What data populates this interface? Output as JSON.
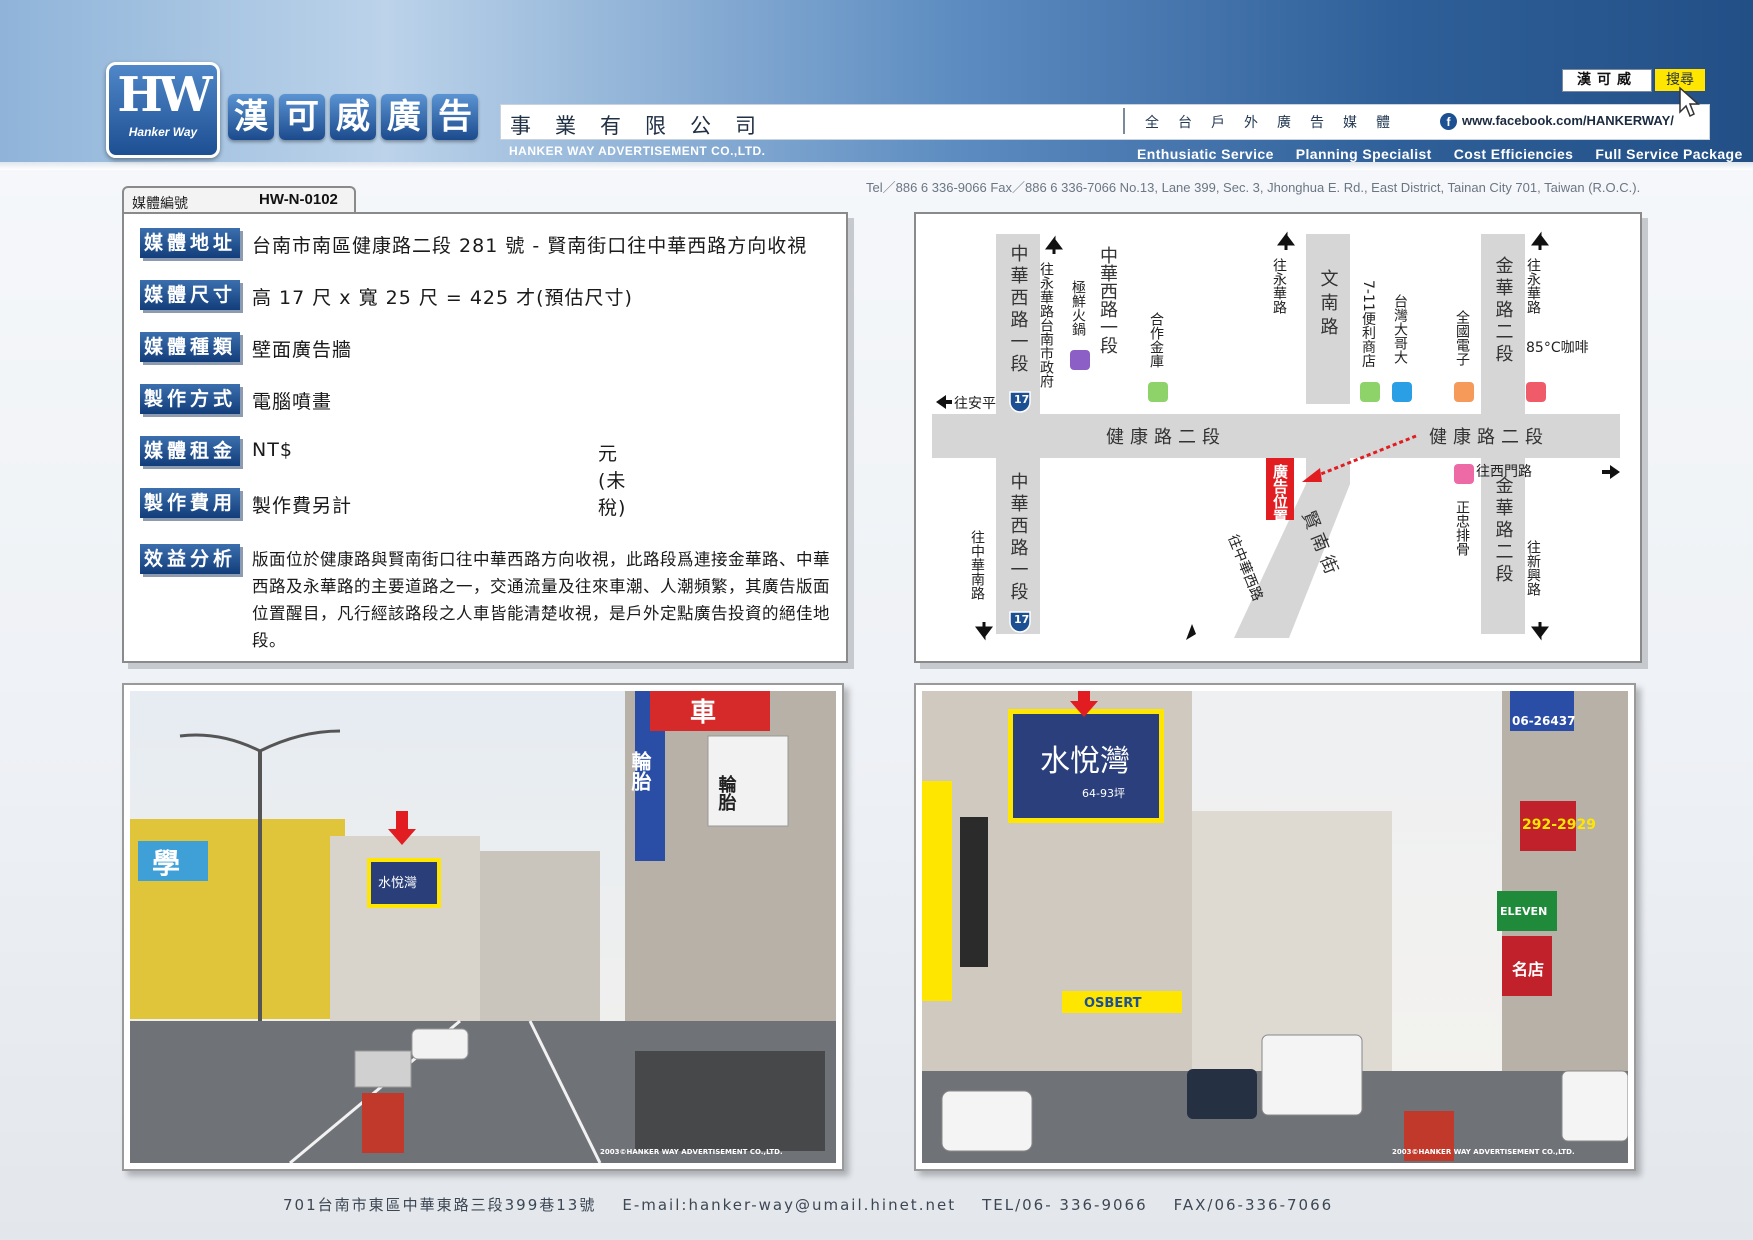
{
  "brand": {
    "logo_mark": "HW",
    "logo_sub": "Hanker Way",
    "name_chars": [
      "漢",
      "可",
      "威",
      "廣",
      "告"
    ],
    "company_zh": "事業有限公司",
    "company_en": "HANKER WAY ADVERTISEMENT CO.,LTD.",
    "slogan_zh": "全台戶外廣告媒體",
    "facebook_url": "www.facebook.com/HANKERWAY/",
    "colors": {
      "primary": "#1d4f93",
      "highlight": "#ffe600",
      "marker": "#e11d22"
    }
  },
  "search": {
    "name": "漢可威",
    "button": "搜尋"
  },
  "taglines": [
    "Enthusiatic Service",
    "Planning Specialist",
    "Cost Efficiencies",
    "Full Service Package"
  ],
  "contact_line": "Tel／886 6 336-9066   Fax／886 6 336-7066   No.13, Lane 399, Sec. 3, Jhonghua E. Rd., East District, Tainan City 701, Taiwan (R.O.C.).",
  "media": {
    "label": "媒體編號",
    "code": "HW-N-0102"
  },
  "info": [
    {
      "label": "媒體地址",
      "value": "台南市南區健康路二段 281 號 - 賢南街口往中華西路方向收視"
    },
    {
      "label": "媒體尺寸",
      "value": "高 17 尺 x 寬 25 尺 = 425 才(預估尺寸)"
    },
    {
      "label": "媒體種類",
      "value": "壁面廣告牆"
    },
    {
      "label": "製作方式",
      "value": "電腦噴畫"
    },
    {
      "label": "媒體租金",
      "value": "NT$",
      "unit": "元 (未稅)"
    },
    {
      "label": "製作費用",
      "value": "製作費另計"
    },
    {
      "label": "效益分析",
      "value": "版面位於健康路與賢南街口往中華西路方向收視，此路段爲連接金華路、中華西路及永華路的主要道路之一，交通流量及往來車潮、人潮頻繁，其廣告版面位置醒目，凡行經該路段之人車皆能清楚收視，是戶外定點廣告投資的絕佳地段。"
    }
  ],
  "map": {
    "roads": {
      "zhonghua_w_top": "中華西路一段",
      "zhonghua_w_bottom": "中華西路一段",
      "wennan": "文南路",
      "jinhua_top": "金華路二段",
      "jinhua_bottom": "金華路二段",
      "jiankang_left": "健康路二段",
      "jiankang_right": "健康路二段",
      "xiannan": "賢南街"
    },
    "route_no": "17",
    "directions": {
      "yonghua_tainan_gov": "往永華路台南市政府",
      "anping": "往安平",
      "yonghua_mid": "往永華路",
      "yonghua_right": "往永華路",
      "zhongnan": "往中華南路",
      "zhonghua_w": "往中華西路",
      "ximen": "往西門路",
      "xinxing": "往新興路"
    },
    "landmarks": {
      "hot_pot": "極鮮火鍋",
      "cooperative": "合作金庫",
      "seven_eleven": "7-11便利商店",
      "taiwan_mobile": "台灣大哥大",
      "elec": "全國電子",
      "coffee": "85°C咖啡",
      "ribs": "正忠排骨"
    },
    "ad_marker": "廣告位置"
  },
  "photos": {
    "credit": "2003©HANKER WAY ADVERTISEMENT CO.,LTD.",
    "billboard_text": "水悅灣",
    "left_signs": {
      "tire": "輪胎",
      "tire_big": "輪胎",
      "school": "學",
      "red_sign": "車"
    },
    "right_signs": {
      "osbert": "OSBERT",
      "eleven": "ELEVEN",
      "phone": "06-26437",
      "num": "292-2929",
      "price": "64-93坪",
      "store": "名店"
    }
  },
  "footer": {
    "address": "701台南市東區中華東路三段399巷13號",
    "email": "E-mail:hanker-way@umail.hinet.net",
    "tel": "TEL/06- 336-9066",
    "fax": "FAX/06-336-7066"
  }
}
